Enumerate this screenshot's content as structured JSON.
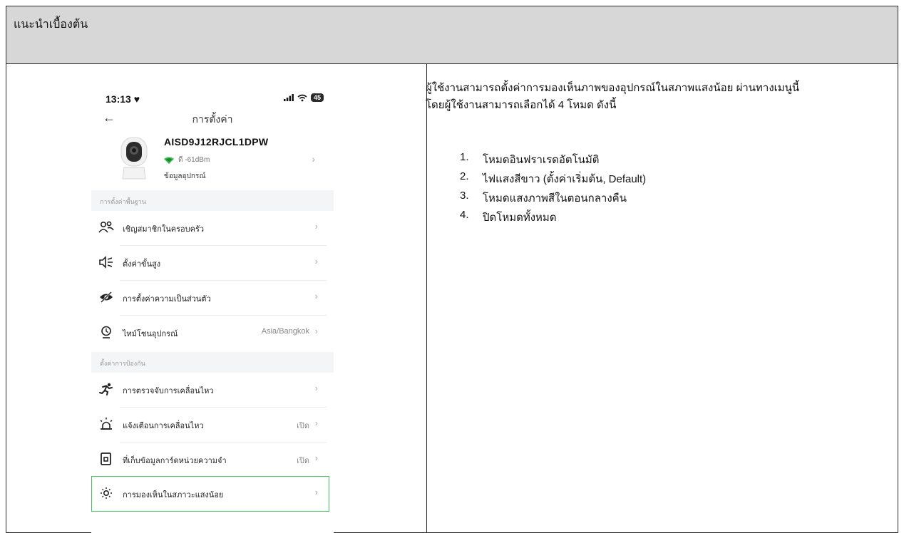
{
  "header": {
    "title": "แนะนำเบื้องต้น"
  },
  "phone": {
    "status": {
      "time": "13:13 ♥",
      "battery": "45"
    },
    "nav": {
      "title": "การตั้งค่า"
    },
    "device": {
      "name": "AISD9J12RJCL1DPW",
      "signal": "ดี -61dBm",
      "info_label": "ข้อมูลอุปกรณ์"
    },
    "sections": [
      {
        "title": "การตั้งค่าพื้นฐาน",
        "rows": [
          {
            "icon": "users-icon",
            "label": "เชิญสมาชิกในครอบครัว",
            "value": ""
          },
          {
            "icon": "speaker-icon",
            "label": "ตั้งค่าขั้นสูง",
            "value": ""
          },
          {
            "icon": "eye-off-icon",
            "label": "การตั้งค่าความเป็นส่วนตัว",
            "value": ""
          },
          {
            "icon": "timezone-icon",
            "label": "ไทม์โซนอุปกรณ์",
            "value": "Asia/Bangkok"
          }
        ]
      },
      {
        "title": "ตั้งค่าการป้องกัน",
        "rows": [
          {
            "icon": "running-icon",
            "label": "การตรวจจับการเคลื่อนไหว",
            "value": ""
          },
          {
            "icon": "alarm-light-icon",
            "label": "แจ้งเตือนการเคลื่อนไหว",
            "value": "เปิด"
          },
          {
            "icon": "sd-card-icon",
            "label": "ที่เก็บข้อมูลการ์ดหน่วยความจำ",
            "value": "เปิด"
          },
          {
            "icon": "sun-icon",
            "label": "การมองเห็นในสภาวะแสงน้อย",
            "value": ""
          }
        ]
      }
    ]
  },
  "description": {
    "paragraph_line1": "ผู้ใช้งานสามารถตั้งค่าการมองเห็นภาพของอุปกรณ์ในสภาพแสงน้อย ผ่านทางเมนูนี้",
    "paragraph_line2": "โดยผู้ใช้งานสามารถเลือกได้ 4 โหมด ดังนี้",
    "modes": [
      {
        "num": "1.",
        "text": "โหมดอินฟราเรดอัตโนมัติ"
      },
      {
        "num": "2.",
        "text": "ไฟแสงสีขาว (ตั้งค่าเริ่มต้น, Default)"
      },
      {
        "num": "3.",
        "text": "โหมดแสงภาพสีในตอนกลางคืน"
      },
      {
        "num": "4.",
        "text": "ปิดโหมดทั้งหมด"
      }
    ]
  },
  "colors": {
    "header_bg": "#d7d7d7",
    "highlight": "#3cc65a",
    "section_bg": "#f4f5f7"
  }
}
